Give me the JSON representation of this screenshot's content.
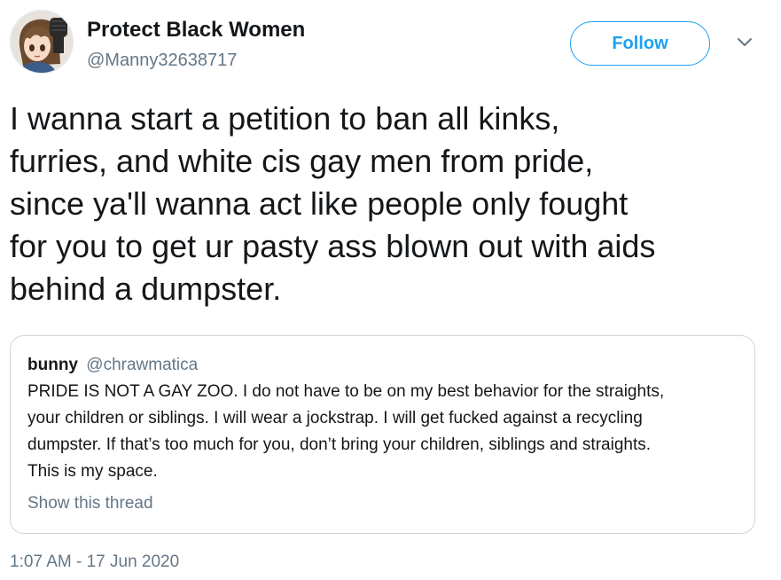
{
  "author": {
    "display_name": "Protect Black Women",
    "handle": "@Manny32638717",
    "avatar_icon": "anime-avatar-with-raised-fist"
  },
  "actions": {
    "follow_label": "Follow",
    "more_icon": "chevron-down-icon"
  },
  "tweet": {
    "text": "I wanna start a petition to ban all kinks,\nfurries, and white cis gay men from pride,\nsince ya'll wanna act like people only fought\nfor you to get ur pasty ass blown out with aids\nbehind a dumpster.",
    "timestamp": "1:07 AM - 17 Jun 2020"
  },
  "quoted_tweet": {
    "name": "bunny",
    "handle": "@chrawmatica",
    "text": "PRIDE IS NOT A GAY ZOO. I do not have to be on my best behavior for the straights,\nyour children or siblings. I will wear a jockstrap. I will get fucked against a recycling\ndumpster. If that’s too much for you, don’t bring your children, siblings and straights.\nThis is my space.",
    "show_thread_label": "Show this thread"
  },
  "colors": {
    "accent": "#1da1f2",
    "secondary_text": "#657786",
    "primary_text": "#14171a",
    "border": "#ccd6dd"
  }
}
